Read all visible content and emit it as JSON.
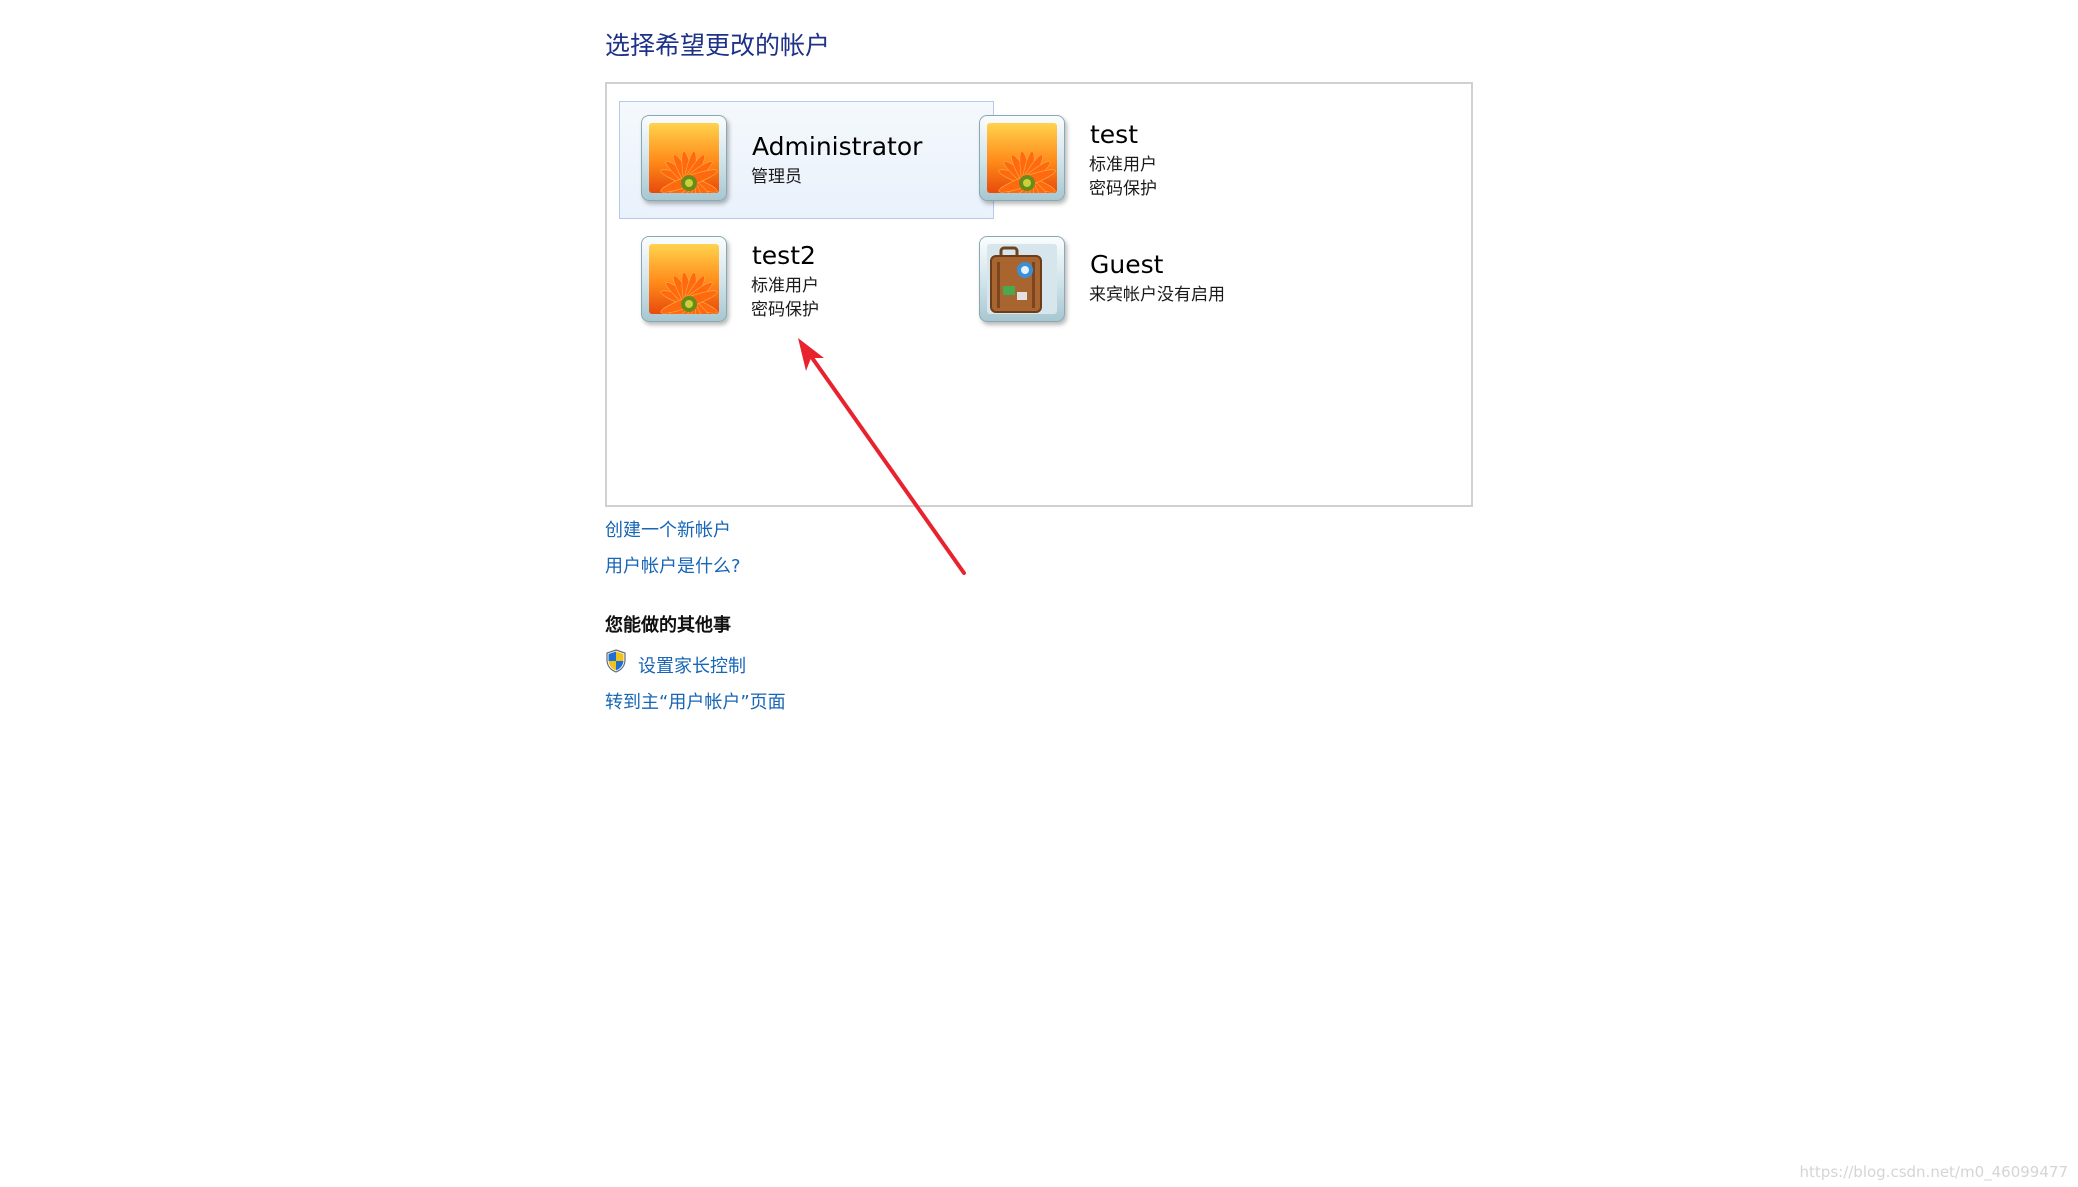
{
  "page_title": "选择希望更改的帐户",
  "accounts": [
    {
      "name": "Administrator",
      "lines": [
        "管理员"
      ],
      "picture": "flower-icon",
      "selected": true
    },
    {
      "name": "test",
      "lines": [
        "标准用户",
        "密码保护"
      ],
      "picture": "flower-icon",
      "selected": false
    },
    {
      "name": "test2",
      "lines": [
        "标准用户",
        "密码保护"
      ],
      "picture": "flower-icon",
      "selected": false
    },
    {
      "name": "Guest",
      "lines": [
        "来宾帐户没有启用"
      ],
      "picture": "suitcase-icon",
      "selected": false
    }
  ],
  "links": {
    "create_account": "创建一个新帐户",
    "what_is_account": "用户帐户是什么?"
  },
  "other_section": {
    "heading": "您能做的其他事",
    "parental_controls": "设置家长控制",
    "goto_main": "转到主“用户帐户”页面"
  },
  "annotation": {
    "type": "arrow",
    "color": "#e8232e",
    "target": "test2 account"
  },
  "colors": {
    "title": "#1e3287",
    "link": "#1766b7",
    "selected_bg": "#e9f1fb",
    "selected_border": "#b3cbe8",
    "panel_border": "#d0d0d0"
  },
  "watermark": "https://blog.csdn.net/m0_46099477"
}
